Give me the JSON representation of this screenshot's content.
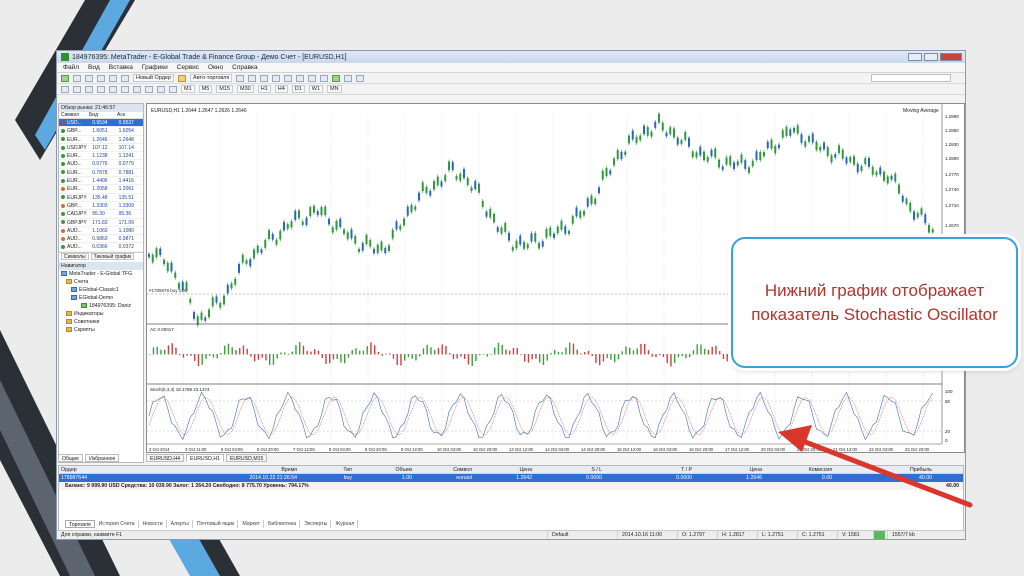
{
  "window": {
    "title": "184976395: MetaTrader - E-Global Trade & Finance Group - Демо Счет - [EURUSD,H1]"
  },
  "menu": [
    "Файл",
    "Вид",
    "Вставка",
    "Графики",
    "Сервис",
    "Окно",
    "Справка"
  ],
  "toolbar": {
    "new_order": "Новый Ордер",
    "auto_trading": "Авто-торговля",
    "timeframes": [
      "M1",
      "M5",
      "M15",
      "M30",
      "H1",
      "H4",
      "D1",
      "W1",
      "MN"
    ]
  },
  "market_watch": {
    "header": "Обзор рынка: 21:46:57",
    "columns": [
      "Символ",
      "Бид",
      "Аск"
    ],
    "rows": [
      {
        "symbol": "USD...",
        "bid": "0.9534",
        "ask": "0.9537",
        "dot": "#d04030",
        "selected": true
      },
      {
        "symbol": "GBP...",
        "bid": "1.6051",
        "ask": "1.6054",
        "dot": "#3a9a3a"
      },
      {
        "symbol": "EUR...",
        "bid": "1.2646",
        "ask": "1.2648",
        "dot": "#3a9a3a"
      },
      {
        "symbol": "USDJPY",
        "bid": "107.12",
        "ask": "107.14",
        "dot": "#3a9a3a"
      },
      {
        "symbol": "EUR...",
        "bid": "1.1238",
        "ask": "1.1241",
        "dot": "#3a9a3a"
      },
      {
        "symbol": "AUD...",
        "bid": "0.0776",
        "ask": "0.0779",
        "dot": "#3a9a3a"
      },
      {
        "symbol": "EUR...",
        "bid": "0.7878",
        "ask": "0.7881",
        "dot": "#3a9a3a"
      },
      {
        "symbol": "EUR...",
        "bid": "1.4406",
        "ask": "1.4416",
        "dot": "#3a9a3a"
      },
      {
        "symbol": "EUR...",
        "bid": "1.2058",
        "ask": "1.2061",
        "dot": "#d0702a"
      },
      {
        "symbol": "EURJPY",
        "bid": "135.48",
        "ask": "135.51",
        "dot": "#3a9a3a"
      },
      {
        "symbol": "GBP...",
        "bid": "1.3303",
        "ask": "1.3309",
        "dot": "#d0702a"
      },
      {
        "symbol": "CADJPY",
        "bid": "95.30",
        "ask": "95.36",
        "dot": "#3a9a3a"
      },
      {
        "symbol": "GBPJPY",
        "bid": "171.83",
        "ask": "171.09",
        "dot": "#3a9a3a"
      },
      {
        "symbol": "AUD...",
        "bid": "1.1060",
        "ask": "1.1080",
        "dot": "#d0702a"
      },
      {
        "symbol": "AUD...",
        "bid": "0.9863",
        "ask": "0.9871",
        "dot": "#d0702a"
      },
      {
        "symbol": "AUD...",
        "bid": "0.0366",
        "ask": "0.0372",
        "dot": "#3a9a3a"
      }
    ],
    "tabs": [
      "Символы",
      "Тиковый график"
    ]
  },
  "navigator": {
    "header": "Навигатор",
    "items": [
      "MetaTrader - E-Global TFG",
      "Счета",
      "EGlobal-Classic1",
      "EGlobal-Demo",
      "184976395: Daniz",
      "Индикаторы",
      "Советники",
      "Скрипты"
    ],
    "tabs": [
      "Общие",
      "Избранное"
    ]
  },
  "chart": {
    "title": "EURUSD,H1 1.2644 1.2647 1.2626 1.2646",
    "indicator_label": "Moving Average",
    "ma_label": "#1789878 buy 1.00",
    "ac_label": "AC 0.00017",
    "stoch_label": "Stoch(5,3,3) 18.1788 23.1374",
    "price_ticks": [
      "1.2890",
      "1.2860",
      "1.2830",
      "1.2800",
      "1.2770",
      "1.2740",
      "1.2710",
      "1.2670"
    ],
    "ac_tick": "-0.00395",
    "stoch_ticks": [
      "100",
      "80",
      "20",
      "0"
    ],
    "time_ticks": [
      "2 Oct 2014",
      "3 Oct 11:00",
      "6 Oct 04:00",
      "6 Oct 20:00",
      "7 Oct 12:00",
      "8 Oct 04:00",
      "8 Oct 20:00",
      "9 Oct 12:00",
      "10 Oct 04:00",
      "10 Oct 20:00",
      "13 Oct 12:00",
      "14 Oct 04:00",
      "14 Oct 20:00",
      "15 Oct 12:00",
      "16 Oct 04:00",
      "16 Oct 20:00",
      "17 Oct 12:00",
      "20 Oct 04:00",
      "20 Oct 20:00",
      "21 Oct 12:00",
      "22 Oct 04:00",
      "22 Oct 20:00"
    ],
    "tabs": [
      "EURUSD,H4",
      "EURUSD,H1",
      "EURUSD,M15"
    ]
  },
  "terminal": {
    "columns": [
      "Ордер",
      "Время",
      "Тип",
      "Объем",
      "Символ",
      "Цена",
      "S / L",
      "T / P",
      "Цена",
      "Комиссия",
      "Прибыль"
    ],
    "row": [
      "178987644",
      "2014.10.22 21:26:54",
      "buy",
      "1.00",
      "eurusd",
      "1.2642",
      "0.0000",
      "0.0000",
      "1.2646",
      "0.00",
      "40.00"
    ],
    "balance": "Баланс: 9 999.90 USD  Средства: 10 039.90  Залог: 1 264.20  Свободно: 8 775.70  Уровень: 794.17%",
    "balance_profit": "40.00",
    "tabs": [
      "Торговля",
      "История Счета",
      "Новости",
      "Алерты",
      "Почтовый ящик",
      "Маркет",
      "Библиотека",
      "Эксперты",
      "Журнал"
    ]
  },
  "status": {
    "help": "Для справки, нажмите F1",
    "profile": "Default",
    "datetime": "2014.10.16 11:00",
    "open": "O: 1.2797",
    "high": "H: 1.2817",
    "low": "L: 1.2751",
    "close": "C: 1.2751",
    "volume": "V: 1581",
    "traffic": "1557/7 kb"
  },
  "callout": {
    "text": "Нижний график отображает показатель Stochastic Oscillator"
  },
  "colors": {
    "accent": "#38a2db",
    "callout_text": "#b5332c",
    "arrow": "#d9362c",
    "candle_up": "#2e9a3a",
    "candle_down": "#2a63c4"
  }
}
